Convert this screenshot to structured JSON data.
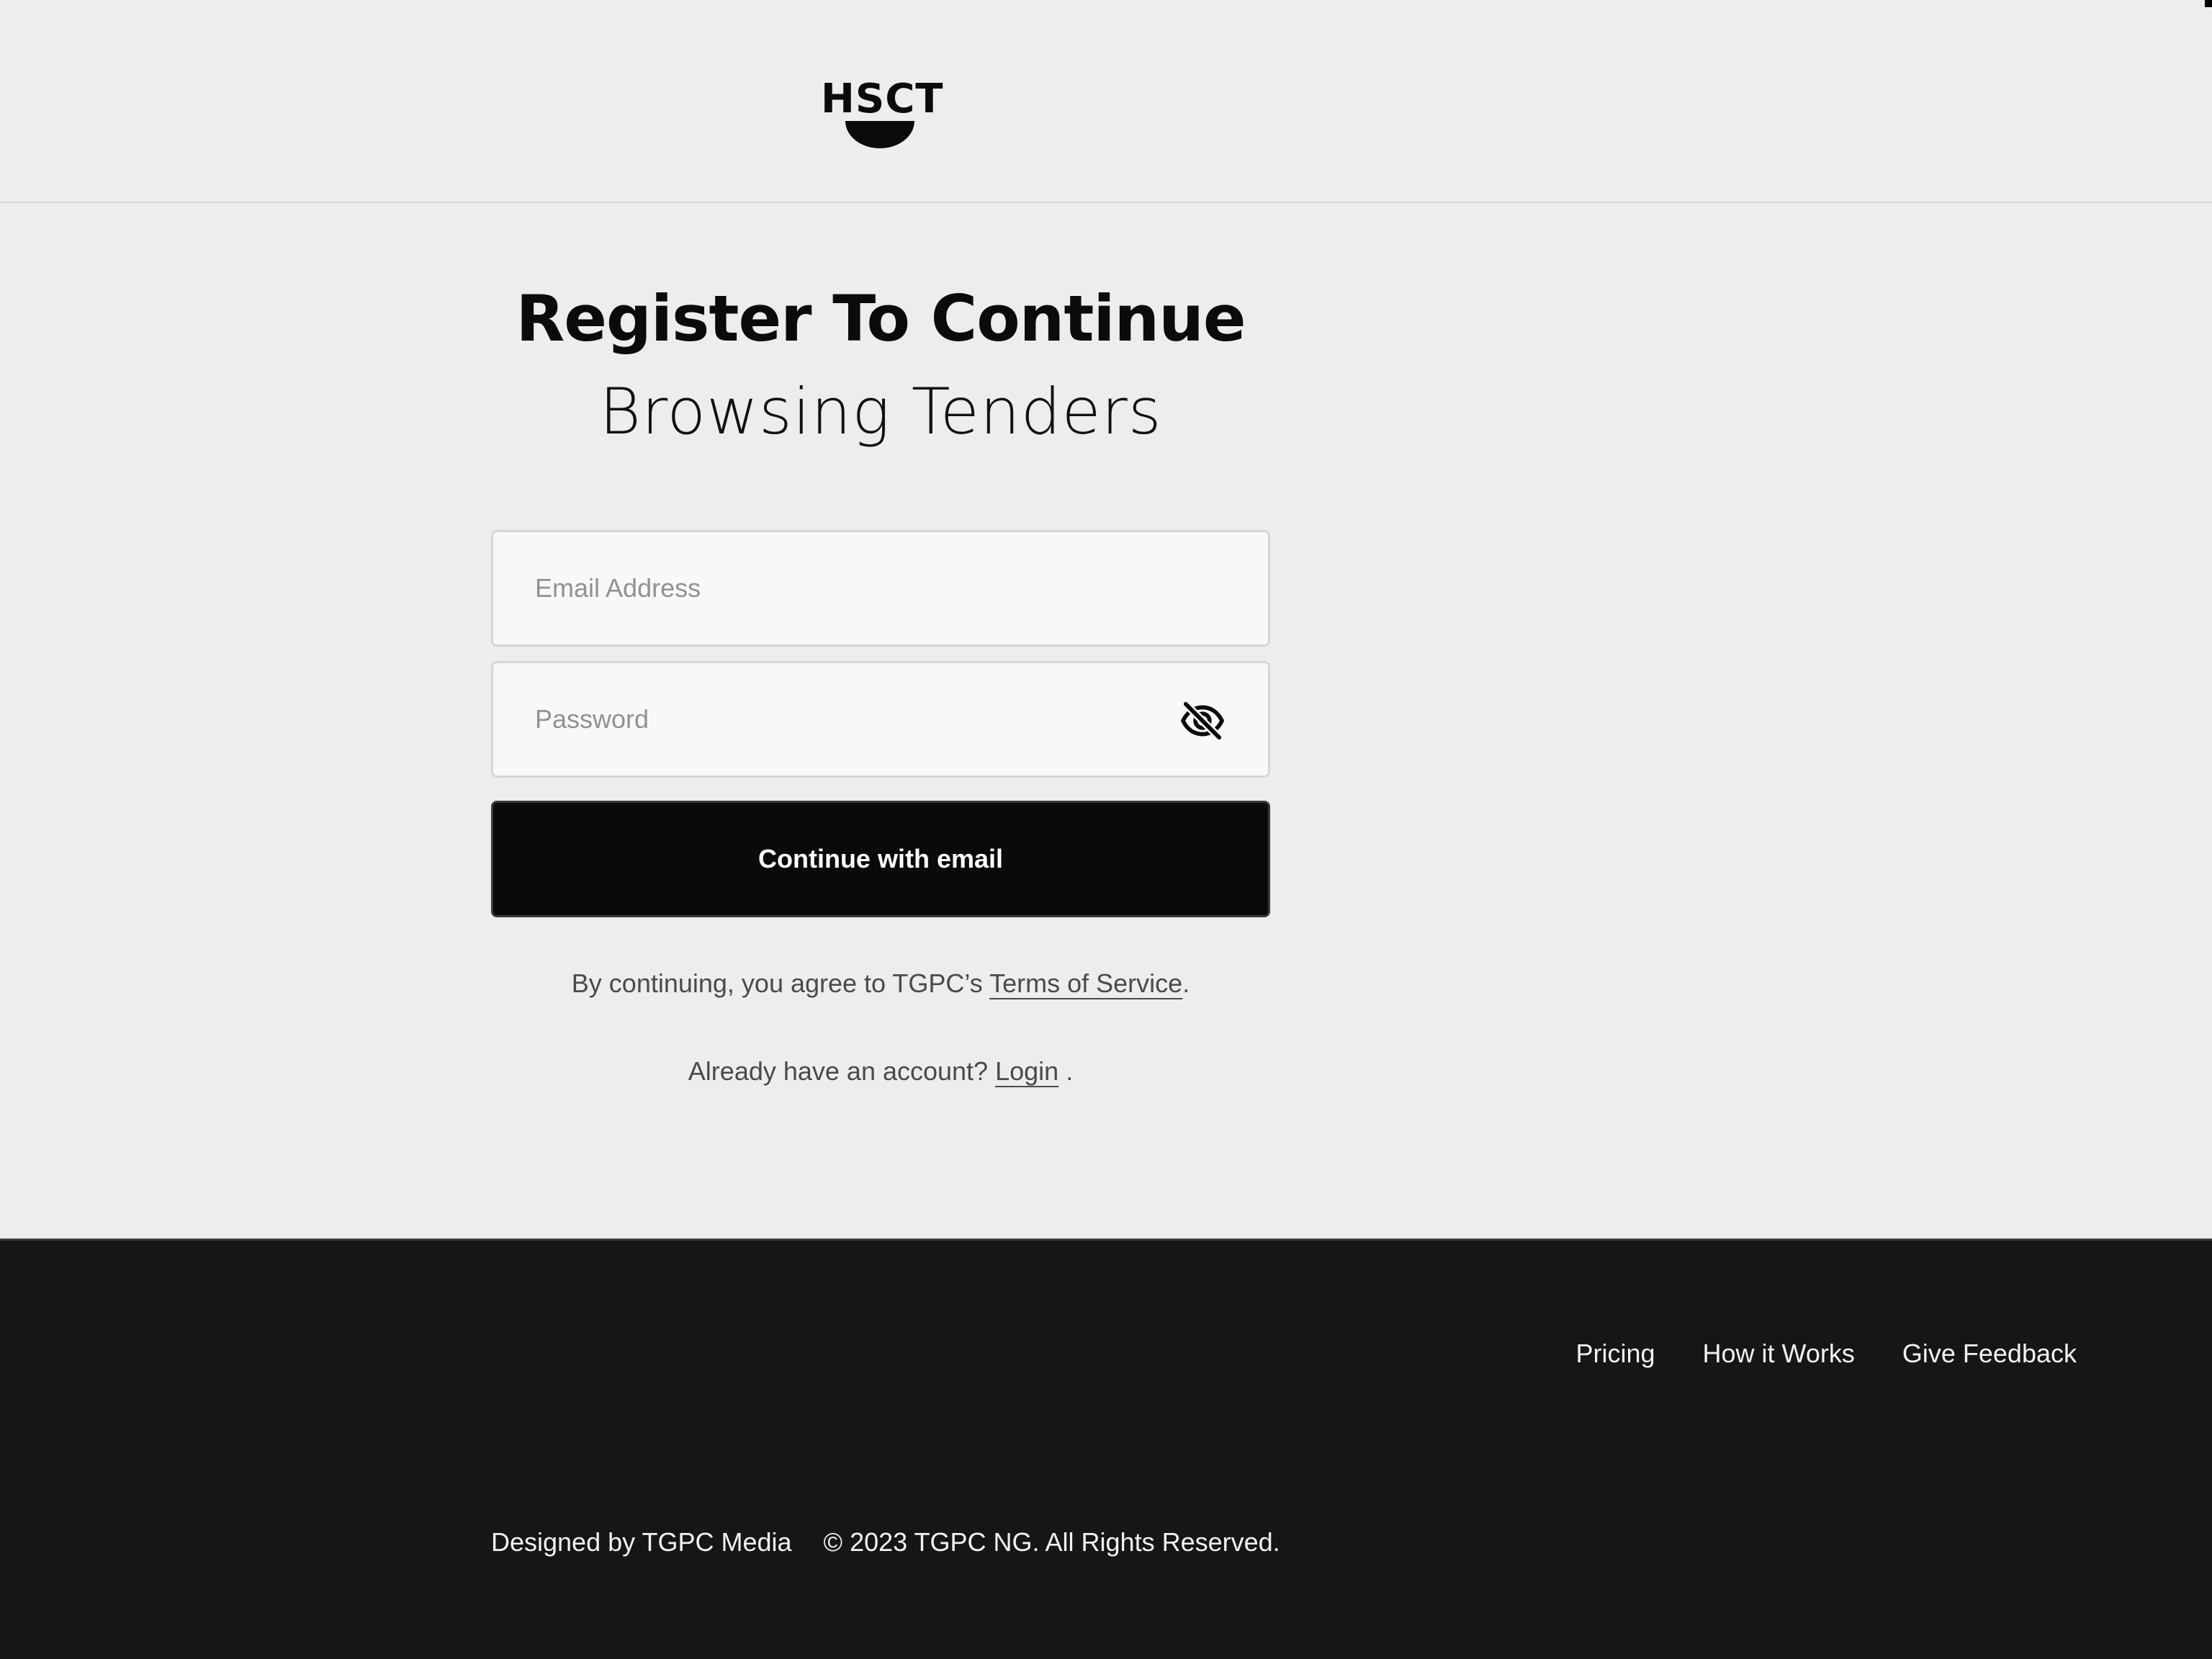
{
  "header": {
    "logo_text": "HSCT"
  },
  "heading": {
    "line1": "Register To Continue",
    "line2": "Browsing Tenders"
  },
  "form": {
    "email_placeholder": "Email Address",
    "email_value": "",
    "password_placeholder": "Password",
    "password_value": "",
    "password_toggle_icon": "eye-off-icon",
    "submit_label": "Continue with email"
  },
  "legal": {
    "prefix": "By continuing, you agree to TGPC’s ",
    "terms_link": "Terms of Service",
    "suffix": "."
  },
  "account": {
    "prefix": "Already have an account? ",
    "login_link": "Login",
    "suffix": " ."
  },
  "footer": {
    "nav": [
      "Pricing",
      "How it Works",
      "Give Feedback"
    ],
    "designed_by": "Designed by TGPC Media",
    "copyright": "© 2023 TGPC NG. All Rights Reserved."
  },
  "colors": {
    "page_background": "#ededed",
    "button_background": "#0a0a0a",
    "footer_background": "#161616"
  }
}
